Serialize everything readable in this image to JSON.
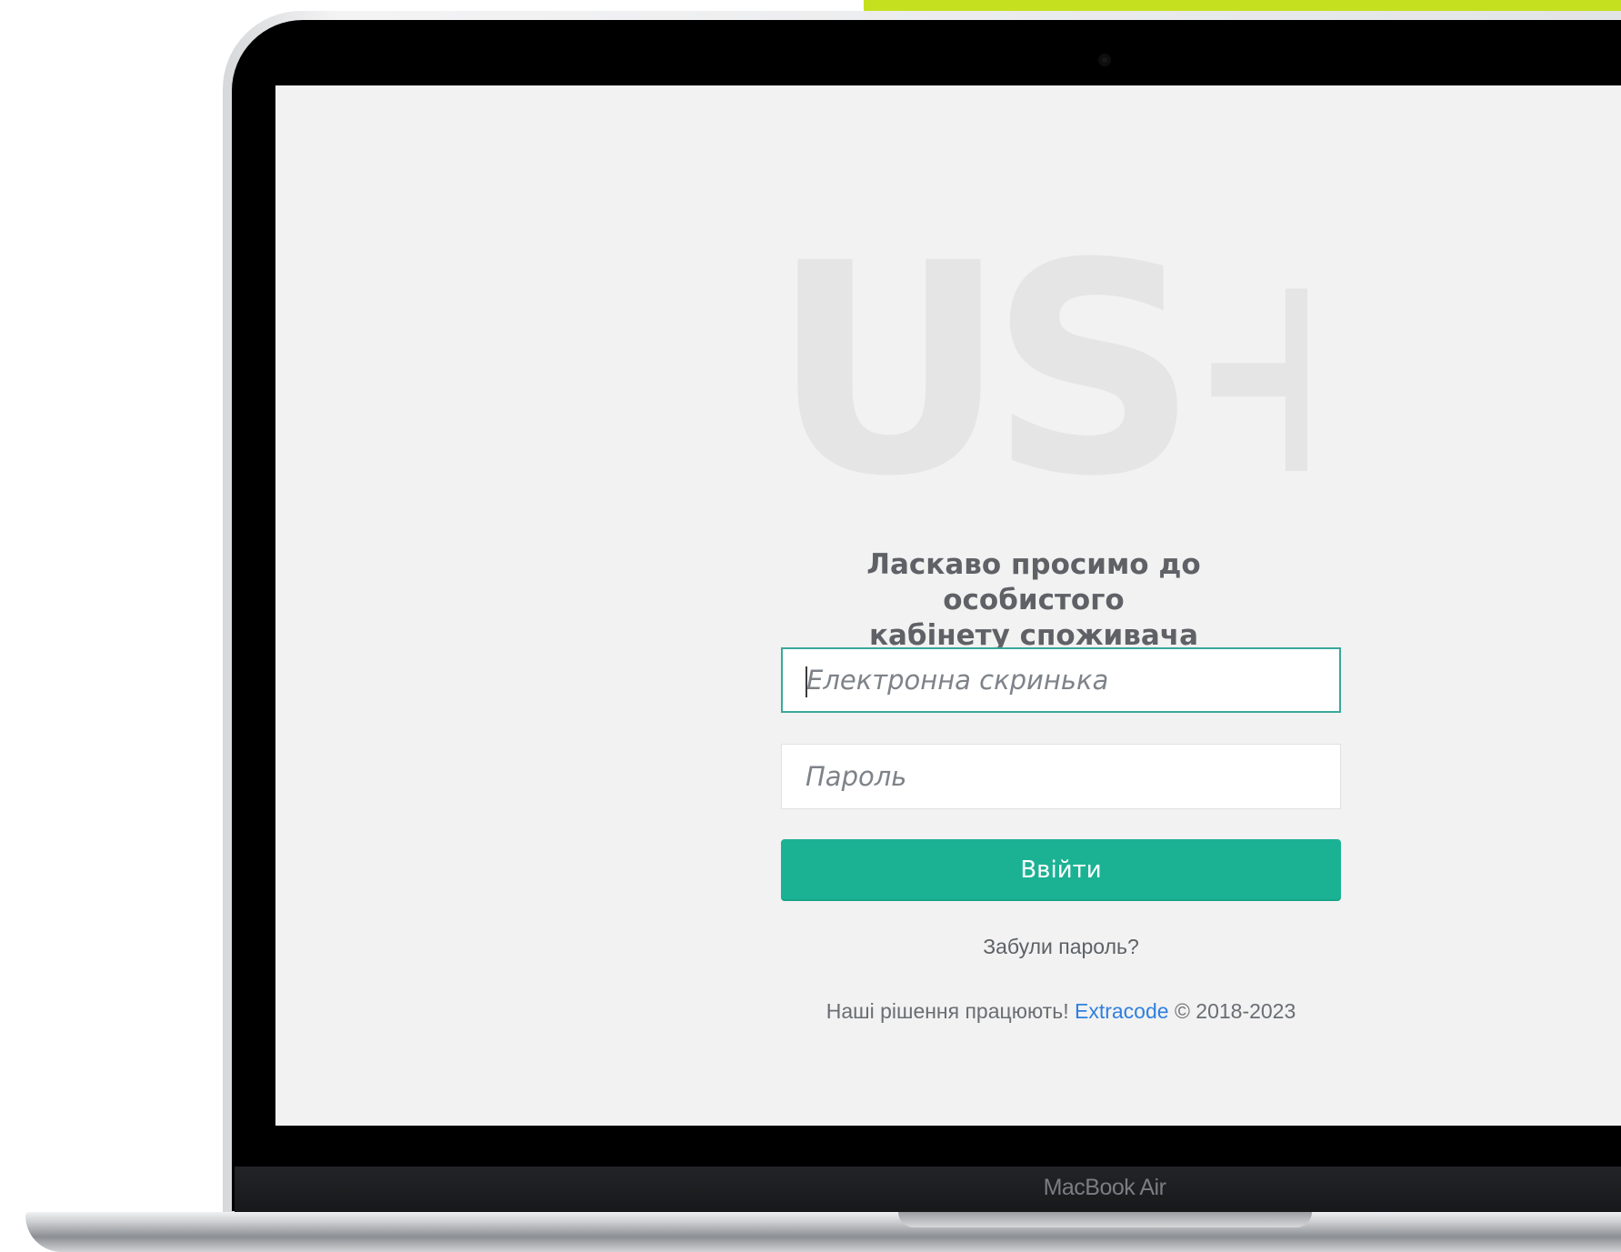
{
  "device": {
    "label": "MacBook Air"
  },
  "brand": {
    "watermark_text": "US+"
  },
  "login": {
    "title_line_1": "Ласкаво просимо до особистого",
    "title_line_2": "кабінету споживача",
    "email_placeholder": "Електронна скринька",
    "password_placeholder": "Пароль",
    "submit_label": "Ввійти",
    "forgot_label": "Забули пароль?"
  },
  "footer": {
    "prefix": "Наші рішення працюють!",
    "link_label": "Extracode",
    "suffix": "© 2018-2023"
  },
  "colors": {
    "accent_strip": "#c5e01f",
    "primary_button": "#1bb294",
    "focus_border": "#39a89a",
    "link": "#2f80e0",
    "screen_background": "#f2f2f2"
  }
}
